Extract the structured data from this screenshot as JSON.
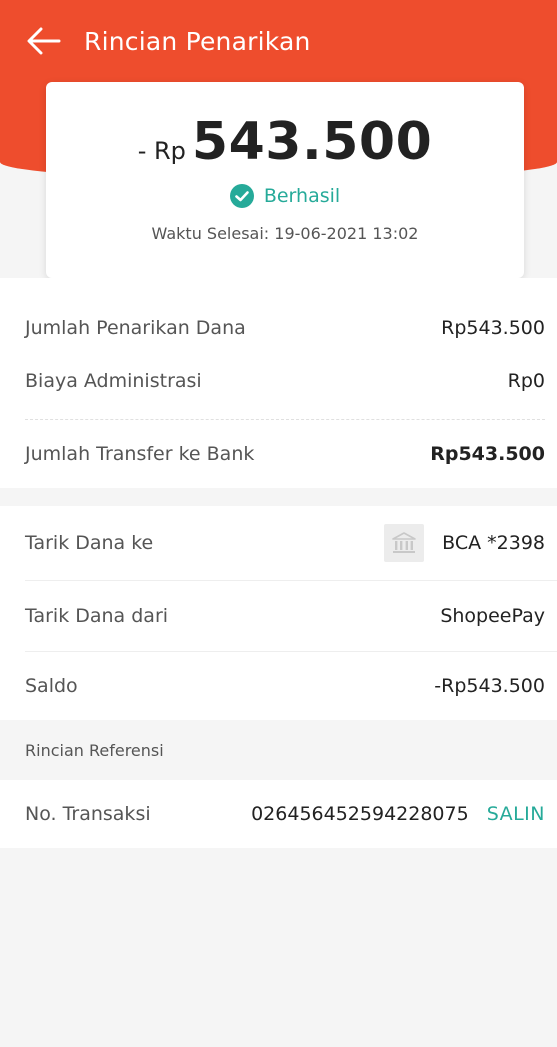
{
  "header": {
    "title": "Rincian Penarikan",
    "back_icon": "arrow-left-icon"
  },
  "summary": {
    "amount_prefix": "- Rp",
    "amount_value": "543.500",
    "status_icon": "check-circle-icon",
    "status_text": "Berhasil",
    "completion_time": "Waktu Selesai: 19-06-2021 13:02"
  },
  "breakdown": {
    "withdrawal_label": "Jumlah Penarikan Dana",
    "withdrawal_value": "Rp543.500",
    "admin_fee_label": "Biaya Administrasi",
    "admin_fee_value": "Rp0",
    "transfer_label": "Jumlah Transfer ke Bank",
    "transfer_value": "Rp543.500"
  },
  "details": {
    "to_label": "Tarik Dana ke",
    "bank_icon": "bank-icon",
    "to_value": "BCA *2398",
    "from_label": "Tarik Dana dari",
    "from_value": "ShopeePay",
    "balance_label": "Saldo",
    "balance_value": "-Rp543.500"
  },
  "reference": {
    "section_title": "Rincian Referensi",
    "transaction_label": "No. Transaksi",
    "transaction_value": "026456452594228075",
    "copy_label": "SALIN"
  },
  "colors": {
    "brand": "#ee4d2d",
    "success": "#26aa99"
  }
}
